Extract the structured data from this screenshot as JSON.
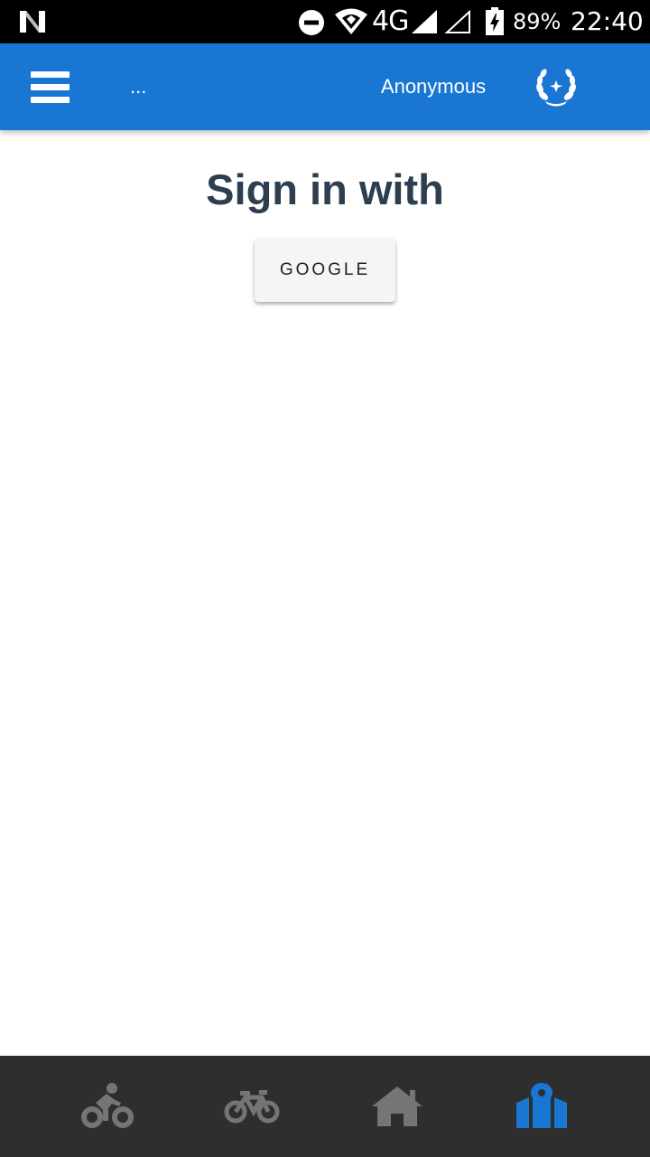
{
  "status_bar": {
    "network_label": "4G",
    "battery_percent": "89%",
    "time": "22:40",
    "icons": [
      "n-logo-icon",
      "do-not-disturb-icon",
      "wifi-icon",
      "cell-signal-icon",
      "cell-signal-empty-icon",
      "battery-charging-icon"
    ]
  },
  "app_bar": {
    "title": "...",
    "username": "Anonymous",
    "menu_icon": "hamburger-menu-icon",
    "avatar_icon": "laurel-wreath-icon",
    "color": "#1976d2"
  },
  "main": {
    "heading": "Sign in with",
    "google_button_label": "GOOGLE"
  },
  "bottom_nav": {
    "items": [
      {
        "icon": "cyclist-icon",
        "active": false
      },
      {
        "icon": "bicycle-icon",
        "active": false
      },
      {
        "icon": "home-icon",
        "active": false
      },
      {
        "icon": "map-marker-icon",
        "active": true
      }
    ],
    "active_color": "#1976d2",
    "inactive_color": "#757575"
  }
}
